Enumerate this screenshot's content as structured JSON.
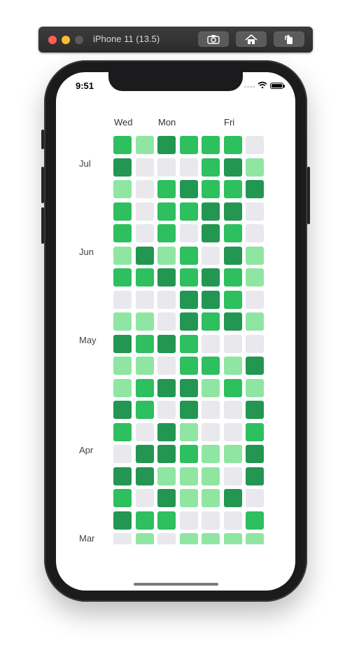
{
  "window": {
    "title": "iPhone 11 (13.5)"
  },
  "status_bar": {
    "time": "9:51"
  },
  "heatmap": {
    "day_labels": [
      "Wed",
      "Mon",
      "Fri"
    ],
    "month_labels": [
      "Jul",
      "Jun",
      "May",
      "Apr",
      "Mar"
    ],
    "colors": {
      "0": "#e8e8ed",
      "1": "#8fe6a2",
      "2": "#2ebf5f",
      "3": "#239652"
    },
    "rows": [
      [
        2,
        1,
        3,
        2,
        2,
        2,
        0
      ],
      [
        3,
        0,
        0,
        0,
        2,
        3,
        1
      ],
      [
        1,
        0,
        2,
        3,
        2,
        2,
        3
      ],
      [
        2,
        0,
        2,
        2,
        3,
        3,
        0
      ],
      [
        2,
        0,
        2,
        0,
        3,
        2,
        0
      ],
      [
        1,
        3,
        1,
        2,
        0,
        3,
        1
      ],
      [
        2,
        2,
        3,
        2,
        3,
        2,
        1
      ],
      [
        0,
        0,
        0,
        3,
        3,
        2,
        0
      ],
      [
        1,
        1,
        0,
        3,
        2,
        3,
        1
      ],
      [
        3,
        2,
        3,
        2,
        0,
        0,
        0
      ],
      [
        1,
        1,
        0,
        2,
        2,
        1,
        3
      ],
      [
        1,
        2,
        3,
        3,
        1,
        2,
        1
      ],
      [
        3,
        2,
        0,
        3,
        0,
        0,
        3
      ],
      [
        2,
        0,
        3,
        1,
        0,
        0,
        2
      ],
      [
        0,
        3,
        3,
        2,
        1,
        1,
        3
      ],
      [
        3,
        3,
        1,
        1,
        1,
        0,
        3
      ],
      [
        2,
        0,
        3,
        1,
        1,
        3,
        0
      ],
      [
        3,
        2,
        2,
        0,
        0,
        0,
        2
      ],
      [
        0,
        1,
        0,
        1,
        1,
        1,
        1
      ]
    ]
  }
}
